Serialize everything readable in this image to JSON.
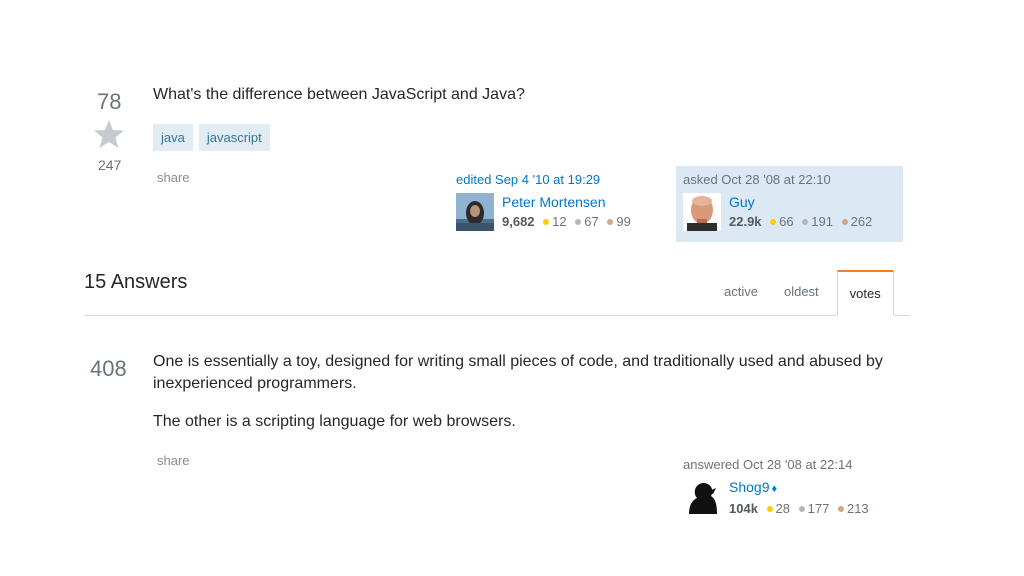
{
  "question": {
    "score": "78",
    "favorite_count": "247",
    "title": "What's the difference between JavaScript and Java?",
    "tags": [
      "java",
      "javascript"
    ],
    "share_label": "share",
    "edited": {
      "action": "edited Sep 4 '10 at 19:29",
      "user_name": "Peter Mortensen",
      "reputation": "9,682",
      "gold": "12",
      "silver": "67",
      "bronze": "99"
    },
    "asked": {
      "action": "asked Oct 28 '08 at 22:10",
      "user_name": "Guy",
      "reputation": "22.9k",
      "gold": "66",
      "silver": "191",
      "bronze": "262"
    }
  },
  "answers_header": {
    "count_label": "15 Answers",
    "tabs": [
      "active",
      "oldest",
      "votes"
    ],
    "selected_tab": "votes"
  },
  "answer": {
    "score": "408",
    "paragraphs": [
      "One is essentially a toy, designed for writing small pieces of code, and traditionally used and abused by inexperienced programmers.",
      "The other is a scripting language for web browsers."
    ],
    "share_label": "share",
    "answered": {
      "action": "answered Oct 28 '08 at 22:14",
      "user_name": "Shog9",
      "moderator_mark": "♦",
      "reputation": "104k",
      "gold": "28",
      "silver": "177",
      "bronze": "213"
    }
  },
  "colors": {
    "link": "#0077cc",
    "tag_bg": "#e1ecf4",
    "owner_card_bg": "#dce9f5",
    "tab_accent": "#f48024",
    "gold": "#ffcc01",
    "silver": "#b4b8bc",
    "bronze": "#d1a684"
  }
}
